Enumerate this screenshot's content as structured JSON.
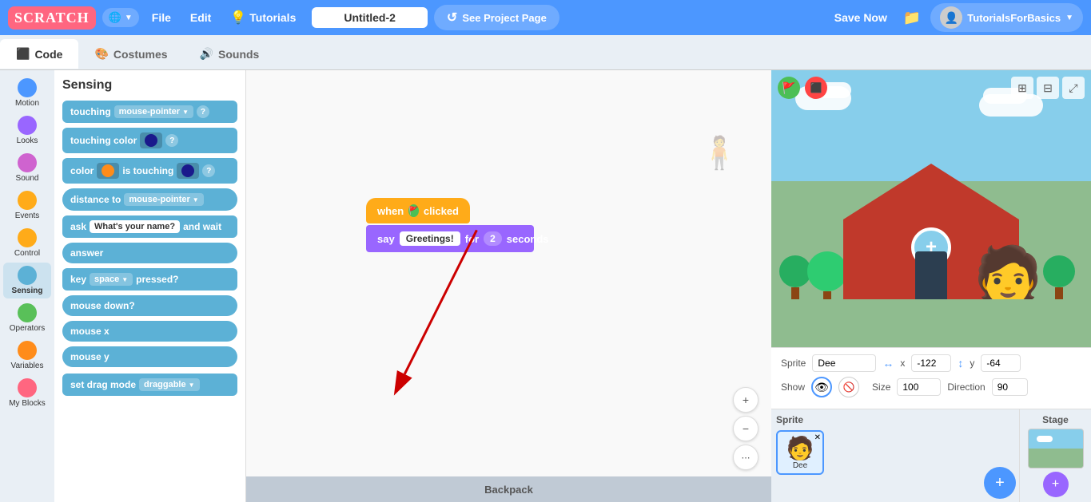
{
  "topnav": {
    "logo": "SCRATCH",
    "globe_label": "🌐 ▼",
    "file_label": "File",
    "edit_label": "Edit",
    "tutorials_label": "Tutorials",
    "project_title": "Untitled-2",
    "see_project_label": "See Project Page",
    "save_now_label": "Save Now",
    "user_label": "TutorialsForBasics",
    "dropdown_arrow": "▼"
  },
  "tabs": {
    "code_label": "Code",
    "costumes_label": "Costumes",
    "sounds_label": "Sounds"
  },
  "categories": [
    {
      "name": "Motion",
      "color": "#4C97FF"
    },
    {
      "name": "Looks",
      "color": "#9966FF"
    },
    {
      "name": "Sound",
      "color": "#CF63CF"
    },
    {
      "name": "Events",
      "color": "#FFAB19"
    },
    {
      "name": "Control",
      "color": "#FFAB19"
    },
    {
      "name": "Sensing",
      "color": "#5CB1D6"
    },
    {
      "name": "Operators",
      "color": "#59C059"
    },
    {
      "name": "Variables",
      "color": "#FF8C1A"
    },
    {
      "name": "My Blocks",
      "color": "#FF6680"
    }
  ],
  "sensing": {
    "title": "Sensing",
    "blocks": [
      {
        "id": "touching",
        "text": "touching",
        "hasDropdown": true,
        "dropdownVal": "mouse-pointer",
        "hasQ": true
      },
      {
        "id": "touching-color",
        "text": "touching color",
        "hasColor": true,
        "colorVal": "#1a1a8c",
        "hasQ": true
      },
      {
        "id": "color-touching",
        "text": "color",
        "hasColorLeft": true,
        "colorLeft": "#FF8C1A",
        "midText": "is touching",
        "hasColorRight": true,
        "colorRight": "#1a1a8c",
        "hasQ": true
      },
      {
        "id": "distance-to",
        "text": "distance to",
        "hasDropdown": true,
        "dropdownVal": "mouse-pointer"
      },
      {
        "id": "ask-wait",
        "text": "ask",
        "inputVal": "What's your name?",
        "endText": "and wait"
      },
      {
        "id": "answer",
        "text": "answer",
        "isRound": true
      },
      {
        "id": "key-pressed",
        "text": "key",
        "hasDropdown": true,
        "dropdownVal": "space",
        "endText": "pressed?"
      },
      {
        "id": "mouse-down",
        "text": "mouse down?",
        "isRound": true
      },
      {
        "id": "mouse-x",
        "text": "mouse x",
        "isRound": true
      },
      {
        "id": "mouse-y",
        "text": "mouse y",
        "isRound": true
      },
      {
        "id": "set-drag",
        "text": "set drag mode",
        "hasDropdown": true,
        "dropdownVal": "draggable"
      }
    ]
  },
  "canvas": {
    "event_block": "when  clicked",
    "say_block_prefix": "say",
    "say_block_text": "Greetings!",
    "say_block_mid": "for",
    "say_block_num": "2",
    "say_block_suffix": "seconds"
  },
  "zoom_controls": {
    "zoom_in": "+",
    "zoom_out": "−",
    "more": "⋯"
  },
  "backpack_label": "Backpack",
  "stage": {
    "sprite_label": "Sprite",
    "sprite_name": "Dee",
    "x_label": "x",
    "x_val": "-122",
    "y_label": "y",
    "y_val": "-64",
    "show_label": "Show",
    "size_label": "Size",
    "size_val": "100",
    "direction_label": "Direction",
    "direction_val": "90"
  },
  "sprites_panel": {
    "title": "Stage",
    "sprite_name": "Dee",
    "add_icon": "+"
  }
}
